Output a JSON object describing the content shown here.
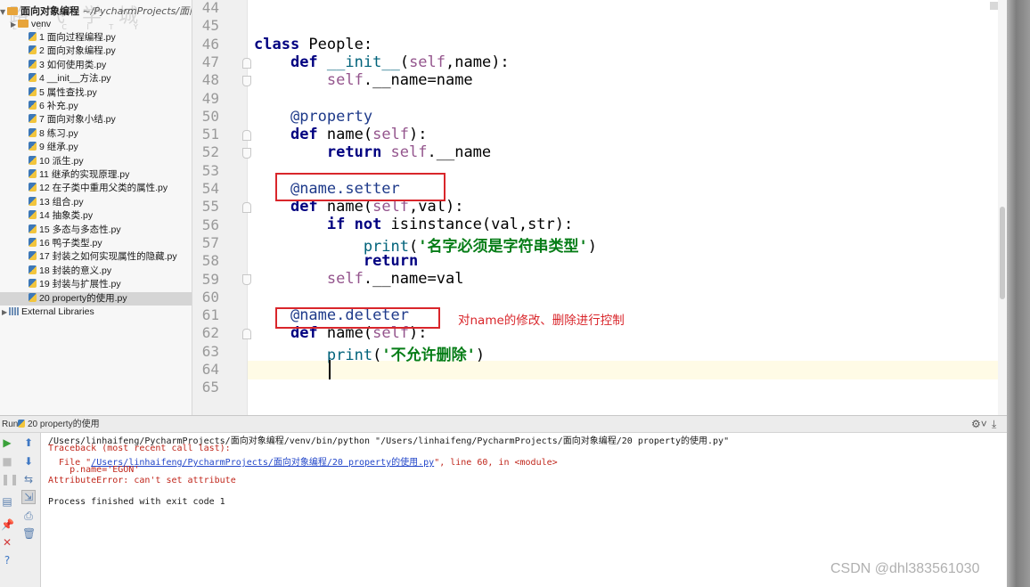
{
  "project": {
    "root_label": "面向对象编程",
    "root_path": "~/PycharmProjects/面向",
    "venv_label": "venv",
    "files": [
      "1 面向过程编程.py",
      "2 面向对象编程.py",
      "3 如何使用类.py",
      "4 __init__方法.py",
      "5 属性查找.py",
      "6 补充.py",
      "7 面向对象小结.py",
      "8 练习.py",
      "9 继承.py",
      "10 派生.py",
      "11 继承的实现原理.py",
      "12 在子类中重用父类的属性.py",
      "13 组合.py",
      "14 抽象类.py",
      "15 多态与多态性.py",
      "16 鸭子类型.py",
      "17 封装之如何实现属性的隐藏.py",
      "18 封装的意义.py",
      "19 封装与扩展性.py",
      "20 property的使用.py"
    ],
    "selected_file": "20 property的使用.py",
    "external_libraries": "External Libraries",
    "watermark": "路 飞 学 城",
    "watermark_sub": "L U  C I T Y"
  },
  "editor": {
    "line_numbers": [
      "44",
      "45",
      "46",
      "47",
      "48",
      "49",
      "50",
      "51",
      "52",
      "53",
      "54",
      "55",
      "56",
      "57",
      "58",
      "59",
      "60",
      "61",
      "62",
      "63",
      "64",
      "65"
    ],
    "code": {
      "l46_kw": "class",
      "l46_rest": " People:",
      "l47_kw": "def",
      "l47_fn": "__init__",
      "l47_p1": "(",
      "l47_self": "self",
      "l47_p2": ",name):",
      "l48_self": "self",
      "l48_rest": ".__name=name",
      "l50": "@property",
      "l51_kw": "def",
      "l51_name": " name(",
      "l51_self": "self",
      "l51_end": "):",
      "l52_kw": "return",
      "l52_self": " self",
      "l52_rest": ".__name",
      "l54": "@name.setter",
      "l55_kw": "def",
      "l55_name": " name(",
      "l55_self": "self",
      "l55_end": ",val):",
      "l56_kw1": "if not",
      "l56_rest": " isinstance(val,str):",
      "l57_fn": "print",
      "l57_p1": "(",
      "l57_str": "'名字必须是字符串类型'",
      "l57_p2": ")",
      "l58_kw": "return",
      "l59_self": "self",
      "l59_rest": ".__name=val",
      "l61": "@name.deleter",
      "l62_kw": "def",
      "l62_name": " name(",
      "l62_self": "self",
      "l62_end": "):",
      "l63_fn": "print",
      "l63_p1": "(",
      "l63_str": "'不允许删除'",
      "l63_p2": ")"
    },
    "annotation": "对name的修改、删除进行控制"
  },
  "run": {
    "label": "Run",
    "config": "20 property的使用",
    "console": {
      "cmd": "/Users/linhaifeng/PycharmProjects/面向对象编程/venv/bin/python \"/Users/linhaifeng/PycharmProjects/面向对象编程/20 property的使用.py\"",
      "traceback": "Traceback (most recent call last):",
      "file_prefix": "  File \"",
      "file_link": "/Users/linhaifeng/PycharmProjects/面向对象编程/20 property的使用.py",
      "file_suffix": "\", line 60, in <module>",
      "code_line": "    p.name='EGON'",
      "error": "AttributeError: can't set attribute",
      "finished": "Process finished with exit code 1"
    }
  },
  "watermark_csdn": "CSDN @dhl383561030"
}
